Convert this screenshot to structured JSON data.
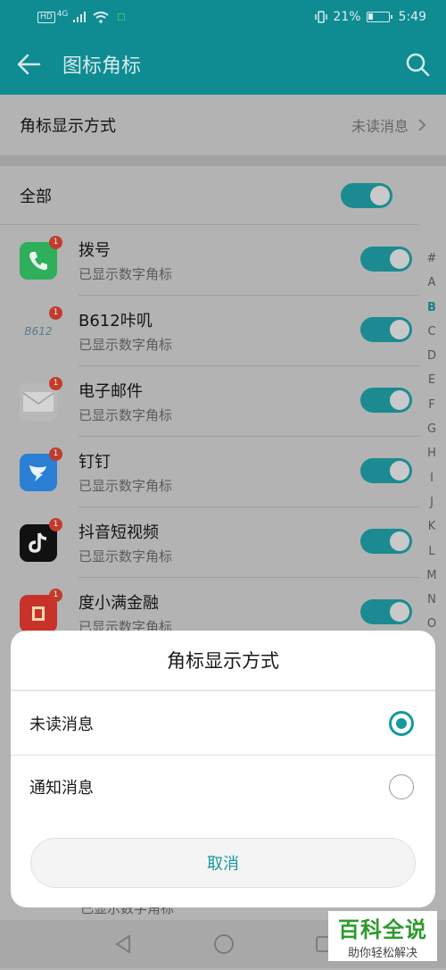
{
  "status_bar": {
    "network_badge": "HD",
    "network_type": "4G",
    "battery_percent": "21%",
    "time": "5:49"
  },
  "app_bar": {
    "title": "图标角标",
    "back_icon": "arrow-left-icon",
    "search_icon": "search-icon"
  },
  "badge_setting": {
    "label": "角标显示方式",
    "value": "未读消息"
  },
  "all_toggle": {
    "label": "全部",
    "on": true
  },
  "apps": [
    {
      "name": "拨号",
      "status": "已显示数字角标",
      "badge": "1",
      "on": true,
      "icon": "phone-icon",
      "color": "#2fae5b"
    },
    {
      "name": "B612咔叽",
      "status": "已显示数字角标",
      "badge": "1",
      "on": true,
      "icon": "b612-icon",
      "color": "#b3b3b3"
    },
    {
      "name": "电子邮件",
      "status": "已显示数字角标",
      "badge": "1",
      "on": true,
      "icon": "mail-icon",
      "color": "#b8b8b8"
    },
    {
      "name": "钉钉",
      "status": "已显示数字角标",
      "badge": "1",
      "on": true,
      "icon": "dingtalk-icon",
      "color": "#2a7fd4"
    },
    {
      "name": "抖音短视频",
      "status": "已显示数字角标",
      "badge": "1",
      "on": true,
      "icon": "douyin-icon",
      "color": "#111111"
    },
    {
      "name": "度小满金融",
      "status": "已显示数字角标",
      "badge": "1",
      "on": true,
      "icon": "duxiaoman-icon",
      "color": "#c8322b"
    }
  ],
  "alphabet_index": [
    "#",
    "A",
    "B",
    "C",
    "D",
    "E",
    "F",
    "G",
    "H",
    "I",
    "J",
    "K",
    "L",
    "M",
    "N",
    "O"
  ],
  "alphabet_active": "B",
  "sheet": {
    "title": "角标显示方式",
    "options": [
      {
        "label": "未读消息",
        "selected": true
      },
      {
        "label": "通知消息",
        "selected": false
      }
    ],
    "cancel": "取消"
  },
  "hidden_row_text": "已显示数字角标",
  "watermark": {
    "title": "百科全说",
    "subtitle": "助你轻松解决"
  }
}
